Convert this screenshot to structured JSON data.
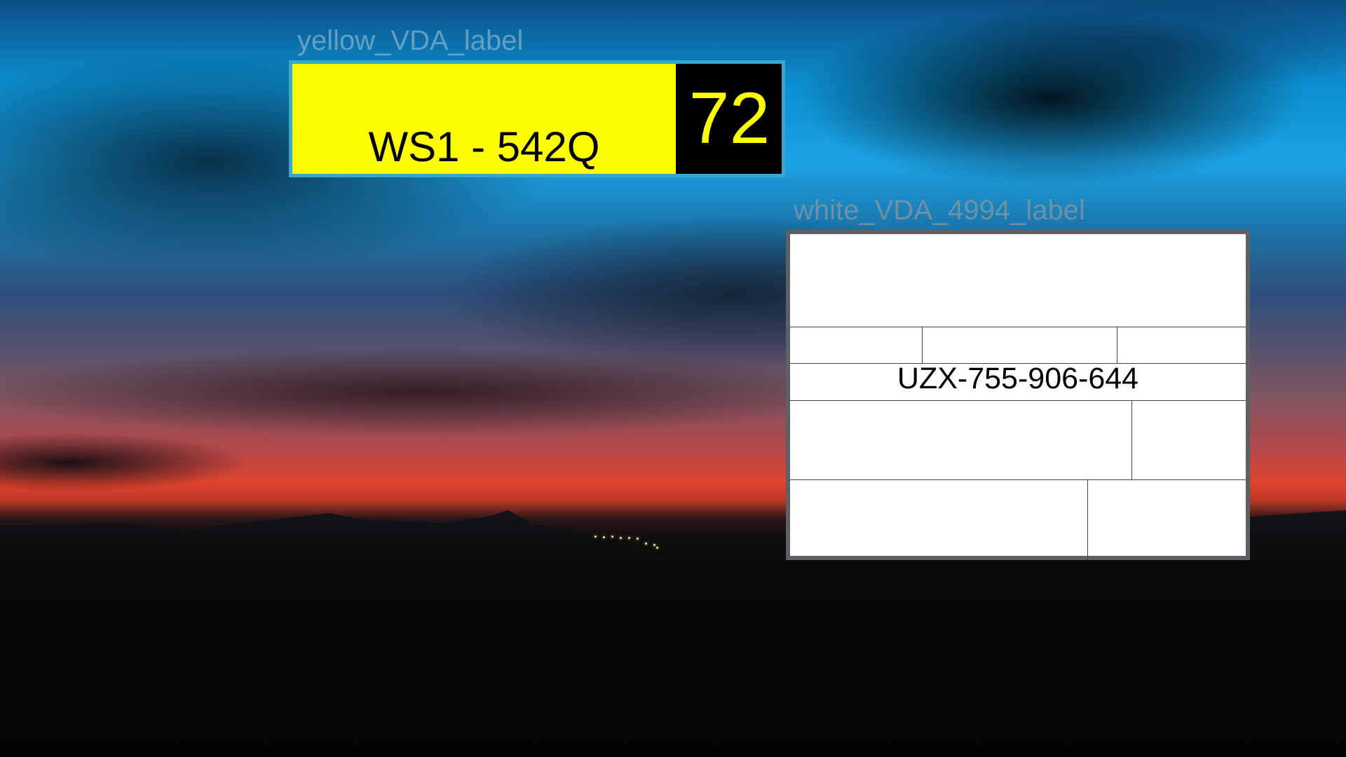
{
  "scene": {
    "background": "sunset-sky-photo",
    "colors": {
      "yellow_label_bg": "#ffff00",
      "yellow_label_border": "#3aa6c9",
      "number_panel_bg": "#000000",
      "number_text": "#ffff00",
      "white_label_bg": "#ffffff",
      "white_label_border": "#5d6166"
    }
  },
  "yellow_label": {
    "caption": "yellow_VDA_label",
    "code": "WS1 - 542Q",
    "number": "72"
  },
  "white_label": {
    "caption": "white_VDA_4994_label",
    "code": "UZX-755-906-644"
  }
}
